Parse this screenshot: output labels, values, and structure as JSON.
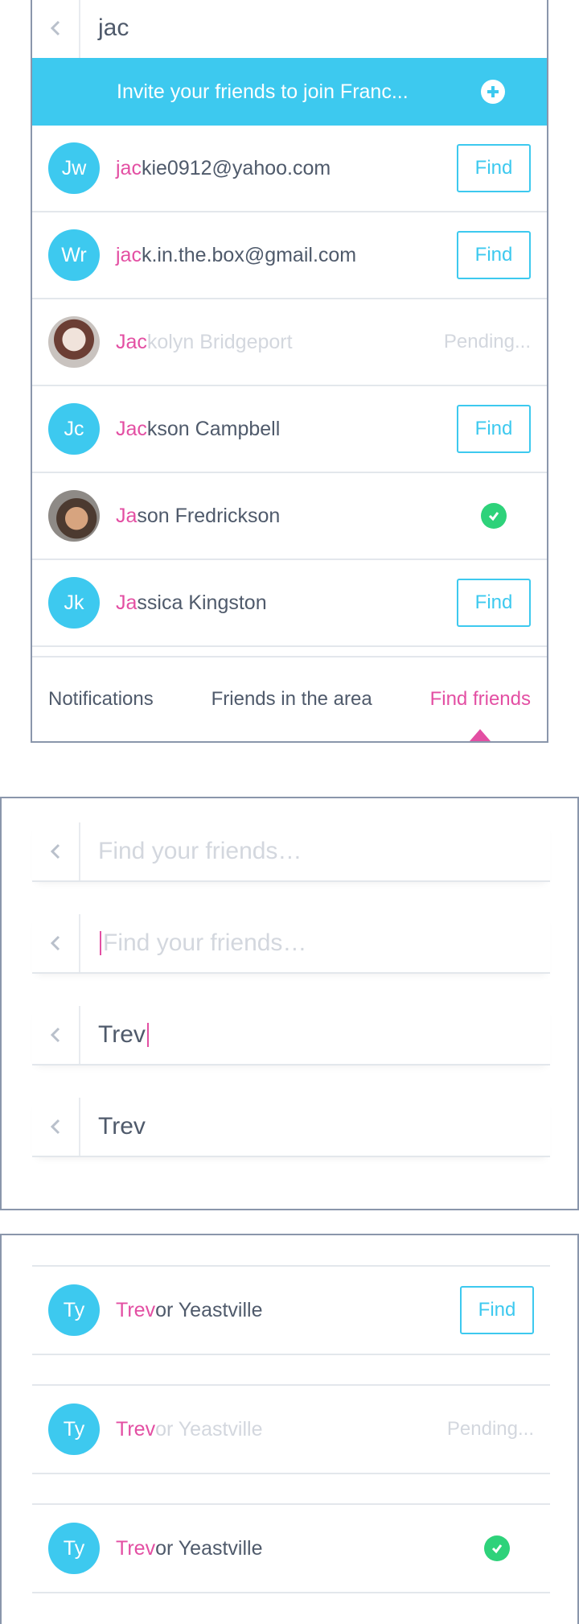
{
  "panel1": {
    "search": {
      "value": "jac"
    },
    "invite": {
      "label": "Invite your friends to join Franc..."
    },
    "rows": [
      {
        "initials": "Jw",
        "hl": "jac",
        "rest": "kie0912@yahoo.com",
        "action": "Find"
      },
      {
        "initials": "Wr",
        "hl": "jac",
        "rest": "k.in.the.box@gmail.com",
        "action": "Find"
      },
      {
        "initials": "",
        "hl": "Jac",
        "rest": "kolyn Bridgeport",
        "action": "Pending..."
      },
      {
        "initials": "Jc",
        "hl": "Jac",
        "rest": "kson Campbell",
        "action": "Find"
      },
      {
        "initials": "",
        "hl": "Ja",
        "rest": "son Fredrickson",
        "action": ""
      },
      {
        "initials": "Jk",
        "hl": "Ja",
        "rest": "ssica Kingston",
        "action": "Find"
      }
    ],
    "tabs": [
      "Notifications",
      "Friends in the area",
      "Find friends"
    ]
  },
  "panel2": {
    "bars": [
      {
        "placeholder": "Find your friends…"
      },
      {
        "placeholder": "Find your friends…"
      },
      {
        "value": "Trev"
      },
      {
        "value": "Trev"
      }
    ]
  },
  "panel3": {
    "rows": [
      {
        "initials": "Ty",
        "hl": "Trev",
        "rest": "or Yeastville",
        "action": "Find"
      },
      {
        "initials": "Ty",
        "hl": "Trev",
        "rest": "or Yeastville",
        "action": "Pending..."
      },
      {
        "initials": "Ty",
        "hl": "Trev",
        "rest": "or Yeastville",
        "action": ""
      }
    ]
  },
  "colors": {
    "accent": "#3dc9ef",
    "highlight": "#e34fa3",
    "success": "#2ed27a",
    "muted": "#d3d7de"
  },
  "icons": [
    "back-chevron-icon",
    "plus-circle-icon",
    "checkmark-circle-icon"
  ]
}
